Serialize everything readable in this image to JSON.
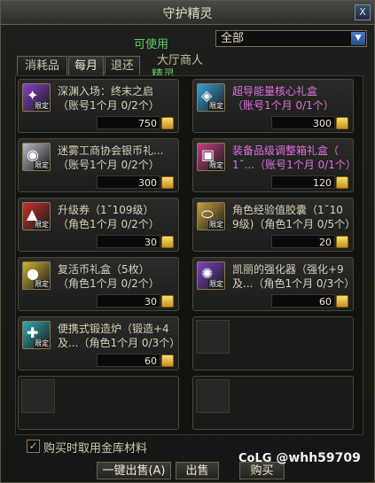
{
  "window": {
    "title": "守护精灵",
    "close_label": "X"
  },
  "background_text": {
    "line1": "可使用",
    "line2": "大厅商人",
    "line3": "精灵"
  },
  "filter": {
    "selected": "全部"
  },
  "tabs": [
    {
      "label": "消耗品"
    },
    {
      "label": "每月"
    },
    {
      "label": "退还"
    }
  ],
  "items": [
    {
      "name": "深渊入场：终末之启",
      "limit": "（账号1个月 0/2个）",
      "price": "750",
      "tag": "限定",
      "color": "#8a40c8"
    },
    {
      "name": "超导能量核心礼盒",
      "limit": "（账号1个月 0/1个）",
      "price": "300",
      "tag": "限定",
      "color": "#3aa0d8",
      "pink": true
    },
    {
      "name": "迷雾工商协会银币礼...",
      "limit": "（账号1个月 0/2个）",
      "price": "300",
      "tag": "限定",
      "color": "#b8b8c8"
    },
    {
      "name": "装备品级调整箱礼盒（",
      "limit": "1˘...（账号1个月 0/1个）",
      "price": "120",
      "tag": "限定",
      "color": "#c04080",
      "pink": true
    },
    {
      "name": "升级券（1˘109级）",
      "limit": "（角色1个月 0/2个）",
      "price": "30",
      "tag": "限定",
      "color": "#c83030"
    },
    {
      "name": "角色经验值胶囊（1˘10",
      "limit": "9级)（角色1个月 0/5个）",
      "price": "20",
      "tag": "限定",
      "color": "#c8a040"
    },
    {
      "name": "复活币礼盒（5枚）",
      "limit": "（角色1个月 0/2个）",
      "price": "30",
      "tag": "限定",
      "color": "#d0b030"
    },
    {
      "name": "凯丽的强化器（强化+9",
      "limit": "及...（角色1个月 0/3个）",
      "price": "60",
      "tag": "限定",
      "color": "#8040c0"
    },
    {
      "name": "便携式锻造炉（锻造+4",
      "limit": "及...（角色1个月 0/3个）",
      "price": "60",
      "tag": "限定",
      "color": "#30a8b0"
    }
  ],
  "checkbox": {
    "label": "购买时取用金库材料",
    "checked": "✓"
  },
  "buttons": {
    "sell_all": "一键出售(A)",
    "sell": "出售",
    "buy": "购买"
  },
  "watermark": {
    "logo": "CoLG",
    "handle": "@whh59709"
  }
}
